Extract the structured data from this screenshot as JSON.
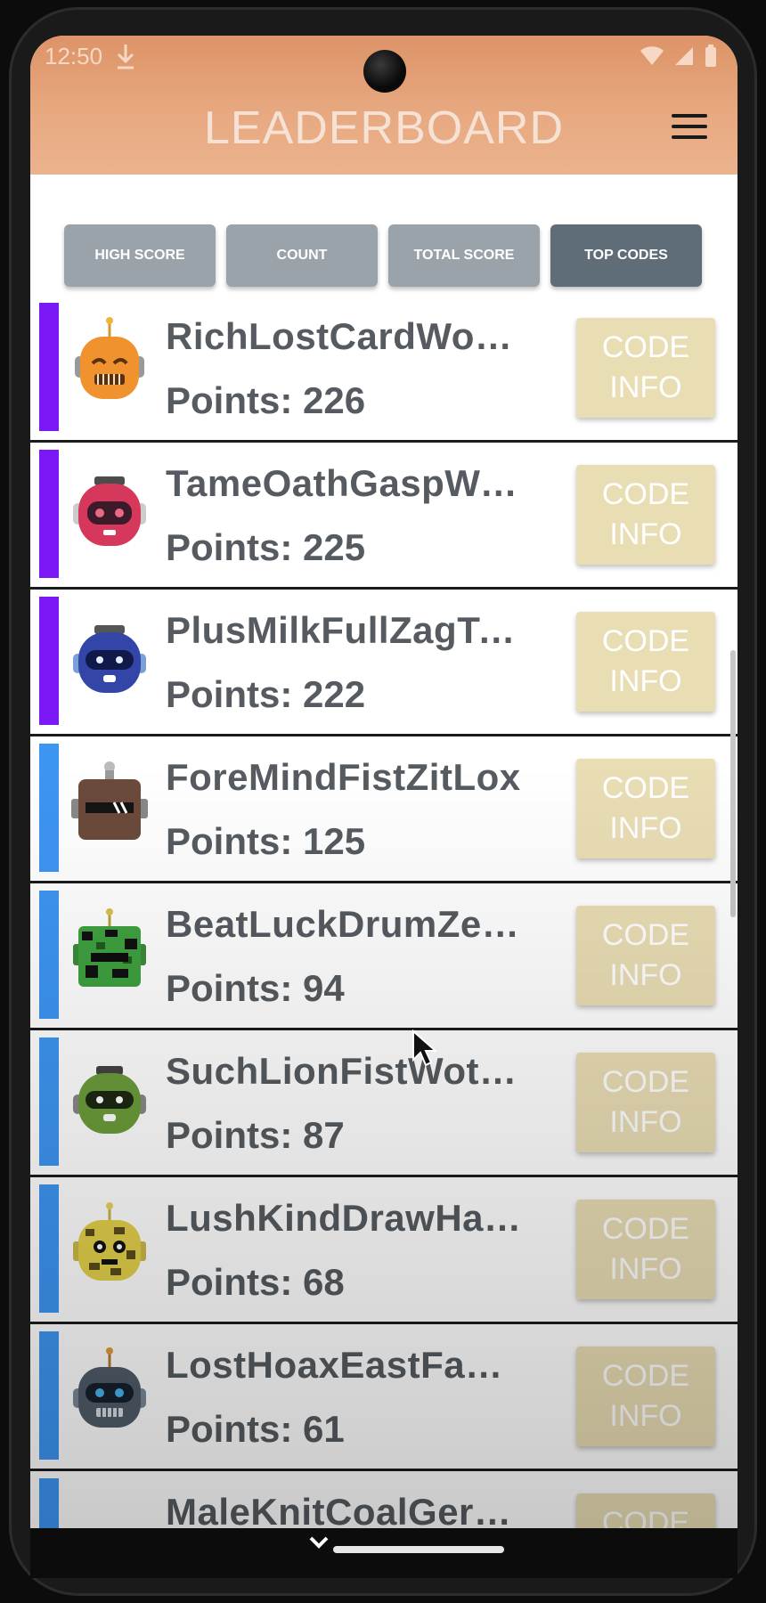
{
  "status": {
    "time": "12:50"
  },
  "header": {
    "title": "LEADERBOARD"
  },
  "tabs": [
    {
      "label": "HIGH SCORE",
      "active": false
    },
    {
      "label": "COUNT",
      "active": false
    },
    {
      "label": "TOTAL SCORE",
      "active": false
    },
    {
      "label": "TOP CODES",
      "active": true
    }
  ],
  "colors": {
    "appbar": "#e4a27a",
    "tier_purple": "#7b18f5",
    "tier_blue": "#3d95f2",
    "code_button": "#e9ddb4"
  },
  "button_label_line1": "CODE",
  "button_label_line2": "INFO",
  "rows": [
    {
      "name": "RichLostCardWokSad",
      "points": "Points: 226",
      "tier": "purple",
      "avatar": "orange-robot-icon"
    },
    {
      "name": "TameOathGaspWosLie",
      "points": "Points: 225",
      "tier": "purple",
      "avatar": "red-robot-icon"
    },
    {
      "name": "PlusMilkFullZagTomb",
      "points": "Points: 222",
      "tier": "purple",
      "avatar": "blue-robot-icon"
    },
    {
      "name": "ForeMindFistZitLox",
      "points": "Points: 125",
      "tier": "blue",
      "avatar": "brown-robot-icon"
    },
    {
      "name": "BeatLuckDrumZenSa…",
      "points": "Points: 94",
      "tier": "blue",
      "avatar": "green-camo-robot-icon"
    },
    {
      "name": "SuchLionFistWotThen",
      "points": "Points: 87",
      "tier": "blue",
      "avatar": "green-robot-icon"
    },
    {
      "name": "LushKindDrawHatSny",
      "points": "Points: 68",
      "tier": "blue",
      "avatar": "yellow-camo-robot-icon"
    },
    {
      "name": "LostHoaxEastFabTape",
      "points": "Points: 61",
      "tier": "blue",
      "avatar": "gray-robot-icon"
    },
    {
      "name": "MaleKnitCoalGermZ…",
      "points": "",
      "tier": "blue",
      "avatar": "orange-robot-icon"
    }
  ]
}
